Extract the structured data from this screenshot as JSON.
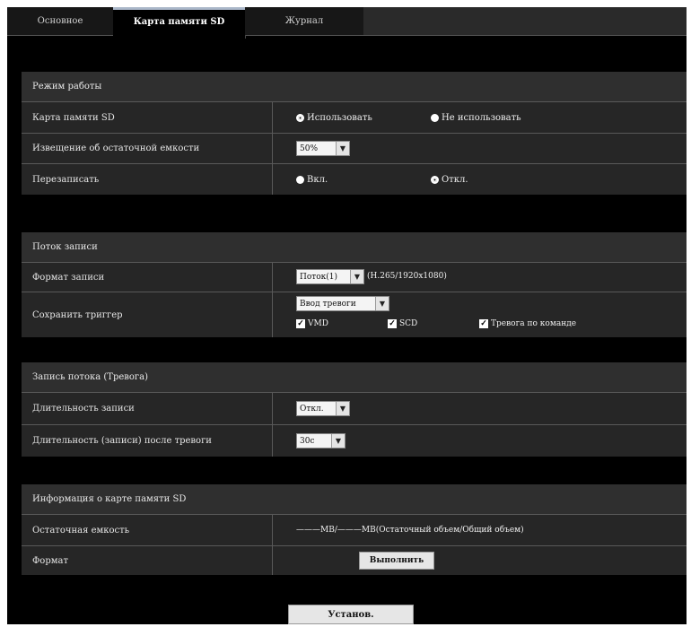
{
  "tabs": [
    {
      "label": "Основное",
      "active": false
    },
    {
      "label": "Карта памяти SD",
      "active": true
    },
    {
      "label": "Журнал",
      "active": false
    }
  ],
  "mode": {
    "title": "Режим работы",
    "sd_card": {
      "label": "Карта памяти SD",
      "opt_use": "Использовать",
      "opt_notuse": "Не использовать",
      "selected": "use"
    },
    "notify": {
      "label": "Извещение об остаточной емкости",
      "value": "50%"
    },
    "overwrite": {
      "label": "Перезаписать",
      "opt_on": "Вкл.",
      "opt_off": "Откл.",
      "selected": "off"
    }
  },
  "stream": {
    "title": "Поток записи",
    "format": {
      "label": "Формат записи",
      "value": "Поток(1)",
      "info": "(H.265/1920x1080)"
    },
    "trigger": {
      "label": "Сохранить триггер",
      "value": "Ввод тревоги",
      "checks": [
        {
          "label": "VMD",
          "checked": true
        },
        {
          "label": "SCD",
          "checked": true
        },
        {
          "label": "Тревога по команде",
          "checked": true
        }
      ]
    }
  },
  "alarm_rec": {
    "title": "Запись потока (Тревога)",
    "pre": {
      "label": "Длительность записи",
      "value": "Откл."
    },
    "post": {
      "label": "Длительность (записи) после тревоги",
      "value": "30с"
    }
  },
  "sd_info": {
    "title": "Информация о карте памяти SD",
    "remaining": {
      "label": "Остаточная емкость",
      "value": "———MB/———MB(Остаточный объем/Общий объем)"
    },
    "format": {
      "label": "Формат",
      "button": "Выполнить"
    }
  },
  "apply_button": "Установ."
}
